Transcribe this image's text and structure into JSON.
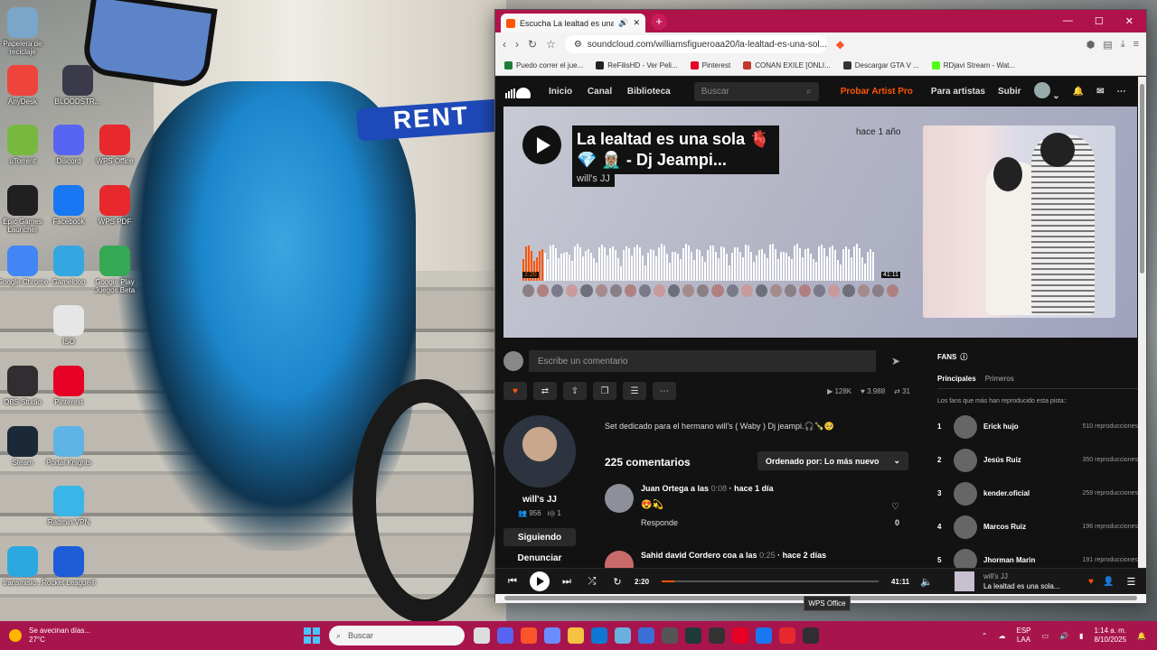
{
  "desktop": {
    "icons": [
      {
        "label": "Papelera de reciclaje",
        "icon": "recycle-bin-icon",
        "color": "#7aa6c9"
      },
      {
        "label": "AnyDesk",
        "icon": "anydesk-icon",
        "color": "#ef443b"
      },
      {
        "label": "BLOODSTR...",
        "icon": "game-icon",
        "color": "#3a3a4a"
      },
      {
        "label": "uTorrent",
        "icon": "utorrent-icon",
        "color": "#77b93e"
      },
      {
        "label": "Discord",
        "icon": "discord-icon",
        "color": "#5865f2"
      },
      {
        "label": "WPS Office",
        "icon": "wps-icon",
        "color": "#e7282c"
      },
      {
        "label": "Epic Games Launcher",
        "icon": "epic-icon",
        "color": "#202020"
      },
      {
        "label": "Facebook",
        "icon": "facebook-icon",
        "color": "#1877f2"
      },
      {
        "label": "WPS PDF",
        "icon": "wps-pdf-icon",
        "color": "#e7282c"
      },
      {
        "label": "Google Chrome",
        "icon": "chrome-icon",
        "color": "#4285f4"
      },
      {
        "label": "Gameloop",
        "icon": "gameloop-icon",
        "color": "#35a7e0"
      },
      {
        "label": "Google Play Juegos Beta",
        "icon": "play-games-icon",
        "color": "#34a853"
      },
      {
        "label": "ISO",
        "icon": "iso-file-icon",
        "color": "#e6e6e6"
      },
      {
        "label": "OBS Studio",
        "icon": "obs-icon",
        "color": "#302e31"
      },
      {
        "label": "Pinterest",
        "icon": "pinterest-icon",
        "color": "#e60023"
      },
      {
        "label": "Steam",
        "icon": "steam-icon",
        "color": "#1b2838"
      },
      {
        "label": "Portal Knights",
        "icon": "portal-knights-icon",
        "color": "#5fb3e5"
      },
      {
        "label": "Radmin VPN",
        "icon": "radmin-icon",
        "color": "#3bb4e7"
      },
      {
        "label": "transmisio...",
        "icon": "transmission-icon",
        "color": "#2ca8e0"
      },
      {
        "label": "Rocket League®",
        "icon": "rocket-league-icon",
        "color": "#1d5ed8"
      }
    ],
    "wallpaper_text": "RENT"
  },
  "browser": {
    "tab_title": "Escucha La lealtad es una sola",
    "url": "soundcloud.com/williamsfigueroaa20/la-lealtad-es-una-sol...",
    "bookmarks": [
      {
        "label": "Puedo correr el jue...",
        "color": "#1a7f37"
      },
      {
        "label": "ReFilisHD - Ver Peli...",
        "color": "#222222"
      },
      {
        "label": "Pinterest",
        "color": "#e60023"
      },
      {
        "label": "CONAN EXILE [ONLI...",
        "color": "#c0392b"
      },
      {
        "label": "Descargar GTA V ...",
        "color": "#333333"
      },
      {
        "label": "RDjavi Stream - Wat...",
        "color": "#53fc18"
      }
    ]
  },
  "soundcloud": {
    "nav": {
      "home": "Inicio",
      "feed": "Canal",
      "library": "Biblioteca",
      "search_placeholder": "Buscar",
      "pro": "Probar Artist Pro",
      "for_artists": "Para artistas",
      "upload": "Subir"
    },
    "track": {
      "title": "La lealtad es una sola 🫀 💎 🧝🏽‍♂️ - Dj Jeampi...",
      "artist": "will's JJ",
      "posted": "hace 1 año",
      "elapsed": "2:20",
      "duration": "41:11",
      "progress": 0.057,
      "description": "Set dedicado para el hermano will's ( Waby ) Dj jeampi.🎧🍾🥺"
    },
    "comment_placeholder": "Escribe un comentario",
    "stats": {
      "plays": "128K",
      "likes": "3.988",
      "reposts": "31"
    },
    "artist_card": {
      "name": "will's JJ",
      "followers": "956",
      "tracks": "1",
      "follow_label": "Siguiendo",
      "report_label": "Denunciar"
    },
    "comments_heading": "225 comentarios",
    "sort_label": "Ordenado por: Lo más nuevo",
    "comments": [
      {
        "author": "Juan Ortega a las",
        "time": "0:08",
        "ago": "· hace 1 día",
        "body": "😍💫",
        "reply": "Responde",
        "likes": "0"
      },
      {
        "author": "Sahid david Cordero coa a las",
        "time": "0:25",
        "ago": "· hace 2 días",
        "body": "",
        "reply": "",
        "likes": ""
      }
    ],
    "fans": {
      "heading": "FANS",
      "tabs": [
        "Principales",
        "Primeros"
      ],
      "subtitle": "Los fans que más han reproducido esta pista::",
      "list": [
        {
          "rank": "1",
          "name": "Erick hujo",
          "plays": "510 reproducciones"
        },
        {
          "rank": "2",
          "name": "Jesús Ruiz",
          "plays": "350 reproducciones"
        },
        {
          "rank": "3",
          "name": "kender.oficial",
          "plays": "259 reproducciones"
        },
        {
          "rank": "4",
          "name": "Marcos Ruiz",
          "plays": "196 reproducciones"
        },
        {
          "rank": "5",
          "name": "Jhorman Marin",
          "plays": "191 reproducciones"
        }
      ]
    },
    "player": {
      "elapsed": "2:20",
      "duration": "41:11",
      "artist": "will's JJ",
      "title": "La lealtad es una sola..."
    },
    "accent_color": "#ff5500"
  },
  "tooltip": "WPS Office",
  "taskbar": {
    "weather_title": "Se avecinan días...",
    "weather_temp": "27°C",
    "search_placeholder": "Buscar",
    "lang": "ESP",
    "lang2": "LAA",
    "time": "1:14 a. m.",
    "date": "8/10/2025"
  }
}
